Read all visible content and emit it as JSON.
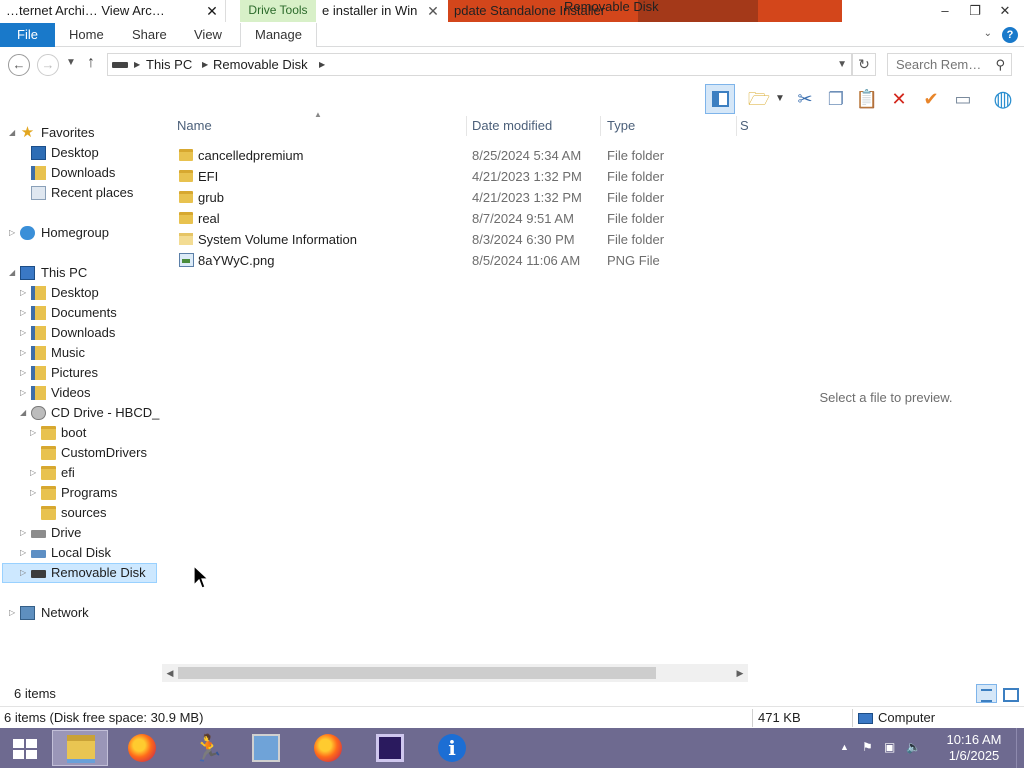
{
  "titlebar": {
    "tab1_title": "…ternet Archi… View Arc…",
    "context_group": "Drive Tools",
    "tab2_title": "e installer in Win",
    "tab3_title": "pdate Standalone Installer",
    "window_title": "Removable Disk",
    "minimize": "–",
    "maximize": "❐",
    "close": "✕"
  },
  "ribbon": {
    "file": "File",
    "home": "Home",
    "share": "Share",
    "view": "View",
    "manage": "Manage",
    "help": "?"
  },
  "address": {
    "crumbs": [
      "This PC",
      "Removable Disk"
    ],
    "search_placeholder": "Search Rem…"
  },
  "nav": {
    "favorites": "Favorites",
    "fav_desktop": "Desktop",
    "fav_downloads": "Downloads",
    "fav_recent": "Recent places",
    "homegroup": "Homegroup",
    "this_pc": "This PC",
    "pc_desktop": "Desktop",
    "pc_documents": "Documents",
    "pc_downloads": "Downloads",
    "pc_music": "Music",
    "pc_pictures": "Pictures",
    "pc_videos": "Videos",
    "cd_drive": "CD Drive - HBCD_",
    "cd_boot": "boot",
    "cd_customdrivers": "CustomDrivers",
    "cd_efi": "efi",
    "cd_programs": "Programs",
    "cd_sources": "sources",
    "drive": "Drive",
    "local_disk": "Local Disk",
    "removable_disk": "Removable Disk",
    "network": "Network"
  },
  "columns": {
    "name": "Name",
    "date_modified": "Date modified",
    "type": "Type",
    "size": "S"
  },
  "files": [
    {
      "name": "cancelledpremium",
      "date": "8/25/2024 5:34 AM",
      "type": "File folder"
    },
    {
      "name": "EFI",
      "date": "4/21/2023 1:32 PM",
      "type": "File folder"
    },
    {
      "name": "grub",
      "date": "4/21/2023 1:32 PM",
      "type": "File folder"
    },
    {
      "name": "real",
      "date": "8/7/2024 9:51 AM",
      "type": "File folder"
    },
    {
      "name": "System Volume Information",
      "date": "8/3/2024 6:30 PM",
      "type": "File folder"
    },
    {
      "name": "8aYWyC.png",
      "date": "8/5/2024 11:06 AM",
      "type": "PNG File"
    }
  ],
  "preview": "Select a file to preview.",
  "status": {
    "item_count": "6 items",
    "detail": "6 items (Disk free space: 30.9 MB)",
    "size": "471 KB",
    "location": "Computer"
  },
  "taskbar": {
    "time": "10:16 AM",
    "date": "1/6/2025"
  }
}
